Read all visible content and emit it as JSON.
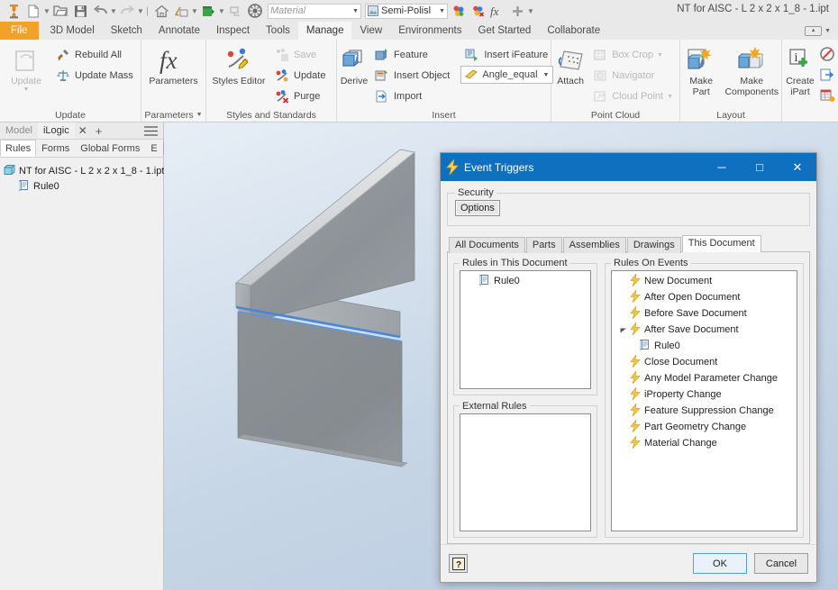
{
  "app": {
    "document_title": "NT for AISC - L 2 x 2 x 1_8 - 1.ipt"
  },
  "quick_access": {
    "material_value": "Material",
    "appearance_value": "Semi-Polisl",
    "icons": [
      "inventor-logo-icon",
      "new-document-icon",
      "new-dropdown-icon",
      "open-icon",
      "save-icon",
      "undo-icon",
      "undo-dropdown-icon",
      "redo-icon",
      "redo-dropdown-icon",
      "home-icon",
      "return-icon",
      "return-dropdown-icon",
      "update-icon",
      "update-dropdown-icon",
      "select-icon",
      "appearance-wheel-icon"
    ],
    "trailing_icons": [
      "appearance-color-icon",
      "clear-appearance-icon",
      "fx-parameters-icon",
      "add-icon",
      "customize-dropdown-icon"
    ]
  },
  "ribbon": {
    "tabs": [
      {
        "label": "File",
        "state": "file"
      },
      {
        "label": "3D Model",
        "state": "normal"
      },
      {
        "label": "Sketch",
        "state": "normal"
      },
      {
        "label": "Annotate",
        "state": "normal"
      },
      {
        "label": "Inspect",
        "state": "normal"
      },
      {
        "label": "Tools",
        "state": "normal"
      },
      {
        "label": "Manage",
        "state": "active"
      },
      {
        "label": "View",
        "state": "normal"
      },
      {
        "label": "Environments",
        "state": "normal"
      },
      {
        "label": "Get Started",
        "state": "normal"
      },
      {
        "label": "Collaborate",
        "state": "normal"
      }
    ],
    "panels": [
      {
        "name": "update",
        "label": "Update",
        "has_dropdown": false,
        "big_button": {
          "label": "Update",
          "disabled": true,
          "icon": "update-icon",
          "has_dropdown": true
        },
        "small_buttons": [
          {
            "label": "Rebuild All",
            "icon": "rebuild-all-icon",
            "disabled": false
          },
          {
            "label": "Update Mass",
            "icon": "update-mass-icon",
            "disabled": false
          }
        ]
      },
      {
        "name": "parameters",
        "label": "Parameters",
        "has_dropdown": true,
        "big_button": {
          "label": "Parameters",
          "disabled": false,
          "icon": "fx-icon",
          "has_dropdown": false
        },
        "small_buttons": []
      },
      {
        "name": "styles-and-standards",
        "label": "Styles and Standards",
        "has_dropdown": false,
        "big_button": {
          "label": "Styles Editor",
          "disabled": false,
          "icon": "styles-editor-icon",
          "has_dropdown": false
        },
        "small_buttons": [
          {
            "label": "Save",
            "icon": "save-style-icon",
            "disabled": true
          },
          {
            "label": "Update",
            "icon": "update-style-icon",
            "disabled": false
          },
          {
            "label": "Purge",
            "icon": "purge-style-icon",
            "disabled": false
          }
        ]
      },
      {
        "name": "insert",
        "label": "Insert",
        "has_dropdown": false,
        "big_button": {
          "label": "Derive",
          "disabled": false,
          "icon": "derive-icon",
          "has_dropdown": false
        },
        "small_buttons": [
          {
            "label": "Feature",
            "icon": "feature-icon",
            "disabled": false
          },
          {
            "label": "Insert Object",
            "icon": "insert-object-icon",
            "disabled": false
          },
          {
            "label": "Import",
            "icon": "import-icon",
            "disabled": false
          }
        ],
        "small_buttons_2": [
          {
            "label": "Insert iFeature",
            "icon": "insert-ifeature-icon",
            "disabled": false
          }
        ],
        "combo": {
          "label": "Angle_equal",
          "icon": "ifeature-icon"
        }
      },
      {
        "name": "point-cloud",
        "label": "Point Cloud",
        "has_dropdown": false,
        "big_button": {
          "label": "Attach",
          "disabled": false,
          "icon": "attach-icon",
          "has_dropdown": false
        },
        "small_buttons": [
          {
            "label": "Box Crop",
            "icon": "box-crop-icon",
            "disabled": true,
            "has_dropdown": true
          },
          {
            "label": "Navigator",
            "icon": "navigator-icon",
            "disabled": true
          },
          {
            "label": "Cloud Point",
            "icon": "cloud-point-icon",
            "disabled": true,
            "has_dropdown": true
          }
        ]
      },
      {
        "name": "layout",
        "label": "Layout",
        "has_dropdown": false,
        "big_buttons": [
          {
            "label": "Make\nPart",
            "label_line1": "Make",
            "label_line2": "Part",
            "icon": "make-part-icon"
          },
          {
            "label": "Make\nComponents",
            "label_line1": "Make",
            "label_line2": "Components",
            "icon": "make-components-icon"
          }
        ]
      },
      {
        "name": "ipart",
        "label": "",
        "big_button": {
          "label_line1": "Create",
          "label_line2": "iPart",
          "icon": "create-ipart-icon"
        },
        "icon_column": [
          "suppress-icon",
          "export-icon",
          "table-icon"
        ]
      }
    ]
  },
  "browser": {
    "tabs": [
      {
        "label": "Model",
        "active": false
      },
      {
        "label": "iLogic",
        "active": true
      }
    ],
    "close_label": "✕",
    "add_label": "+",
    "menu_icon": "hamburger-menu-icon",
    "subtabs": [
      {
        "label": "Rules",
        "active": true
      },
      {
        "label": "Forms",
        "active": false
      },
      {
        "label": "Global Forms",
        "active": false
      },
      {
        "label": "E",
        "active": false
      }
    ],
    "nav_prev": "◄",
    "nav_next": "►",
    "tree": [
      {
        "label": "NT for AISC - L 2 x 2 x 1_8 - 1.ipt",
        "icon": "part-document-icon",
        "level": 0
      },
      {
        "label": "Rule0",
        "icon": "rule-icon",
        "level": 1
      }
    ]
  },
  "canvas": {
    "minitoolbar": {
      "icon1": "constraint-icon",
      "icon2": "edit-constraint-icon"
    }
  },
  "dialog": {
    "title": "Event Triggers",
    "title_icon": "lightning-bolt-icon",
    "window_buttons": {
      "minimize": "─",
      "maximize": "□",
      "close": "✕"
    },
    "security": {
      "legend": "Security",
      "options_label": "Options"
    },
    "tabs": [
      {
        "label": "All Documents",
        "active": false
      },
      {
        "label": "Parts",
        "active": false
      },
      {
        "label": "Assemblies",
        "active": false
      },
      {
        "label": "Drawings",
        "active": false
      },
      {
        "label": "This Document",
        "active": true
      }
    ],
    "rules_in_document": {
      "legend": "Rules in This Document",
      "items": [
        {
          "label": "Rule0",
          "icon": "rule-icon"
        }
      ]
    },
    "external_rules": {
      "legend": "External Rules",
      "items": []
    },
    "rules_on_events": {
      "legend": "Rules On Events",
      "items": [
        {
          "label": "New Document",
          "icon": "event-icon",
          "indent": 0,
          "expander": ""
        },
        {
          "label": "After Open Document",
          "icon": "event-icon",
          "indent": 0,
          "expander": ""
        },
        {
          "label": "Before Save Document",
          "icon": "event-icon",
          "indent": 0,
          "expander": ""
        },
        {
          "label": "After Save Document",
          "icon": "event-icon",
          "indent": 0,
          "expander": "expanded"
        },
        {
          "label": "Rule0",
          "icon": "rule-icon",
          "indent": 1,
          "expander": ""
        },
        {
          "label": "Close Document",
          "icon": "event-icon",
          "indent": 0,
          "expander": ""
        },
        {
          "label": "Any Model Parameter Change",
          "icon": "event-icon",
          "indent": 0,
          "expander": ""
        },
        {
          "label": "iProperty Change",
          "icon": "event-icon",
          "indent": 0,
          "expander": ""
        },
        {
          "label": "Feature Suppression Change",
          "icon": "event-icon",
          "indent": 0,
          "expander": ""
        },
        {
          "label": "Part Geometry Change",
          "icon": "event-icon",
          "indent": 0,
          "expander": ""
        },
        {
          "label": "Material Change",
          "icon": "event-icon",
          "indent": 0,
          "expander": ""
        }
      ]
    },
    "footer": {
      "help_icon": "help-question-icon",
      "ok_label": "OK",
      "cancel_label": "Cancel"
    }
  },
  "colors": {
    "file_tab": "#f2a22a",
    "dialog_title": "#1070c0",
    "ribbon_bg": "#f6f6f6",
    "canvas_top": "#e7eef6",
    "canvas_bottom": "#b9cbe0",
    "model_face": "#8a8e92",
    "highlight_edge": "#4a86d6"
  }
}
